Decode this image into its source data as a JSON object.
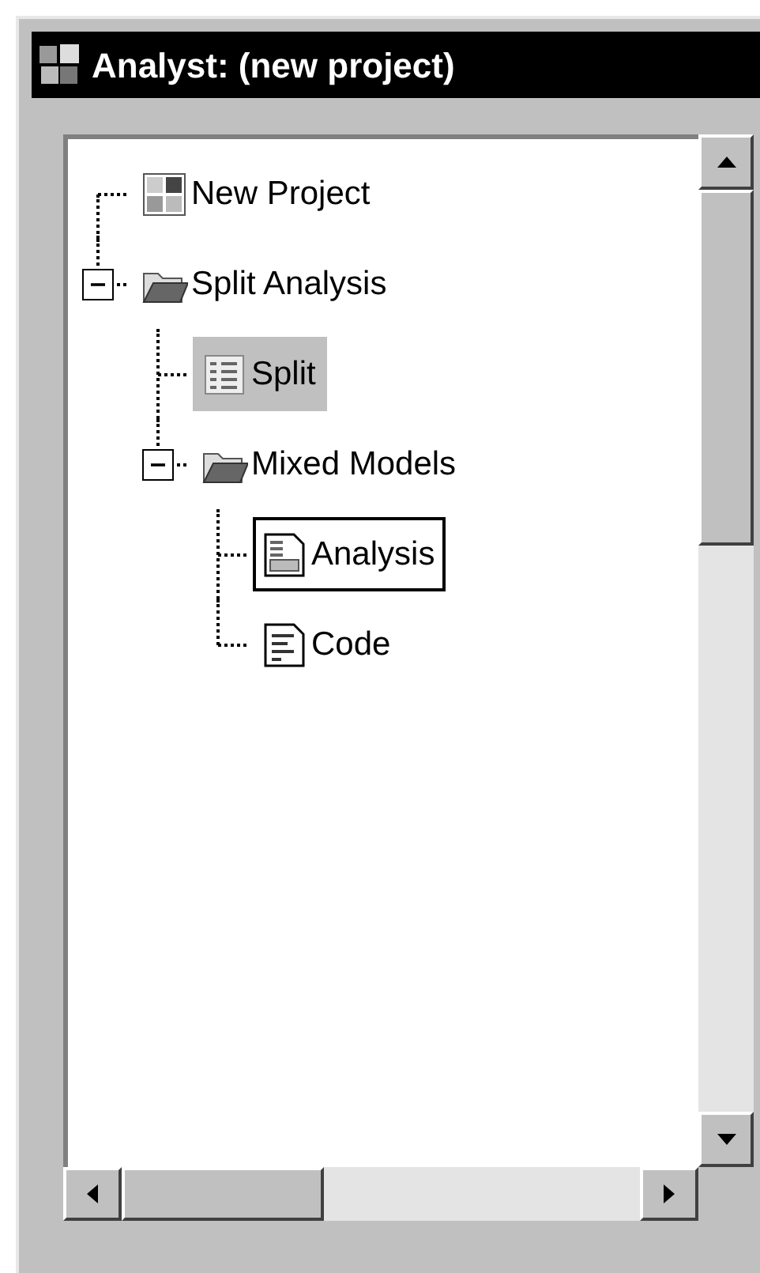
{
  "window": {
    "title": "Analyst: (new project)"
  },
  "tree": [
    {
      "label": "New Project",
      "kind": "project",
      "selected": false,
      "focused": false
    },
    {
      "label": "Split Analysis",
      "kind": "folder",
      "expanded": true,
      "selected": false,
      "focused": false,
      "children": [
        {
          "label": "Split",
          "kind": "table",
          "selected": true,
          "focused": false
        },
        {
          "label": "Mixed Models",
          "kind": "folder",
          "expanded": true,
          "selected": false,
          "focused": false,
          "children": [
            {
              "label": "Analysis",
              "kind": "form",
              "selected": false,
              "focused": true
            },
            {
              "label": "Code",
              "kind": "document",
              "selected": false,
              "focused": false
            }
          ]
        }
      ]
    }
  ]
}
